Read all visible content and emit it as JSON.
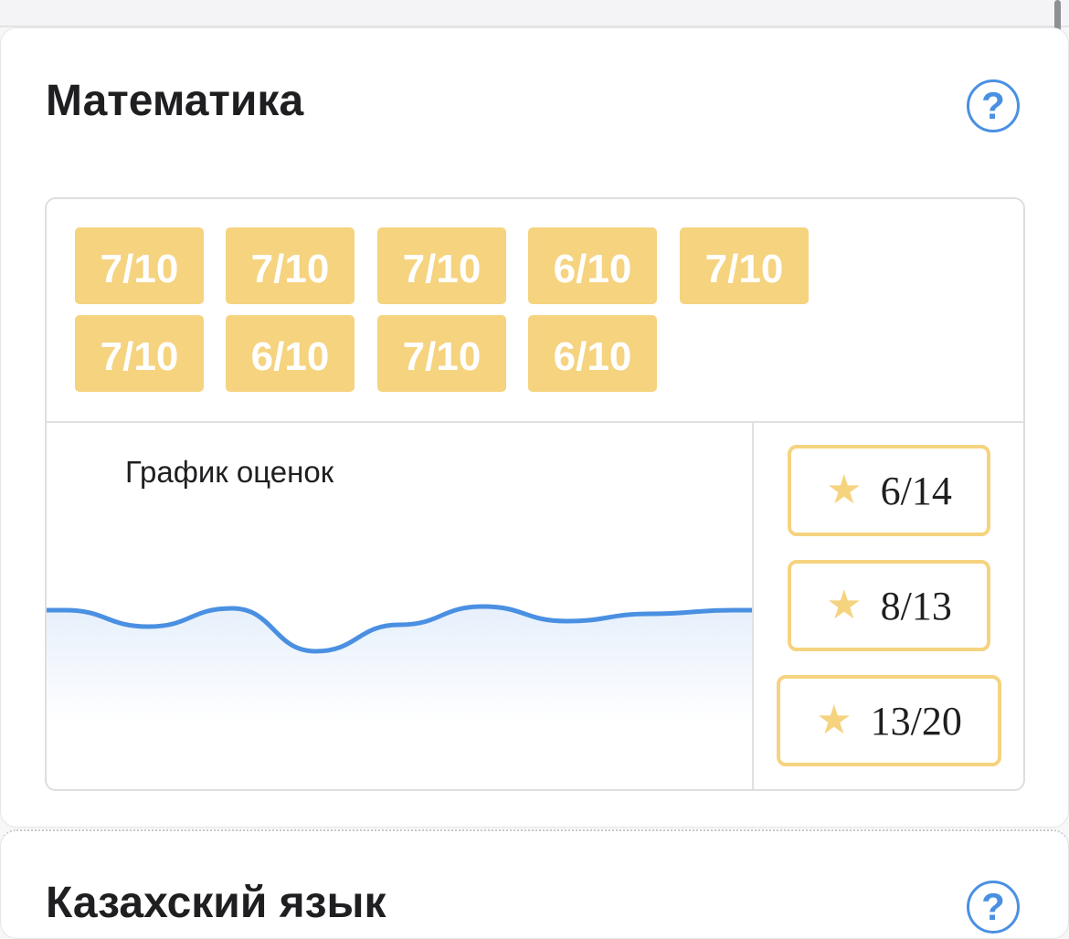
{
  "subjects": [
    {
      "title": "Математика",
      "help_icon": "?",
      "grades": [
        "7/10",
        "7/10",
        "7/10",
        "6/10",
        "7/10",
        "7/10",
        "6/10",
        "7/10",
        "6/10"
      ],
      "chart_title": "График оценок",
      "scores": [
        {
          "star_icon": "★",
          "value": "6/14"
        },
        {
          "star_icon": "★",
          "value": "8/13"
        },
        {
          "star_icon": "★",
          "value": "13/20"
        }
      ]
    },
    {
      "title": "Казахский язык",
      "help_icon": "?"
    }
  ],
  "colors": {
    "accent": "#4a90e2",
    "badge": "#f5d37f"
  },
  "chart_data": {
    "type": "area",
    "title": "График оценок",
    "x": [
      1,
      2,
      3,
      4,
      5,
      6,
      7,
      8,
      9
    ],
    "values": [
      7,
      7,
      7,
      6,
      7,
      7,
      7,
      7,
      7
    ],
    "note_colors": {
      "line": "#4a90e2"
    }
  }
}
